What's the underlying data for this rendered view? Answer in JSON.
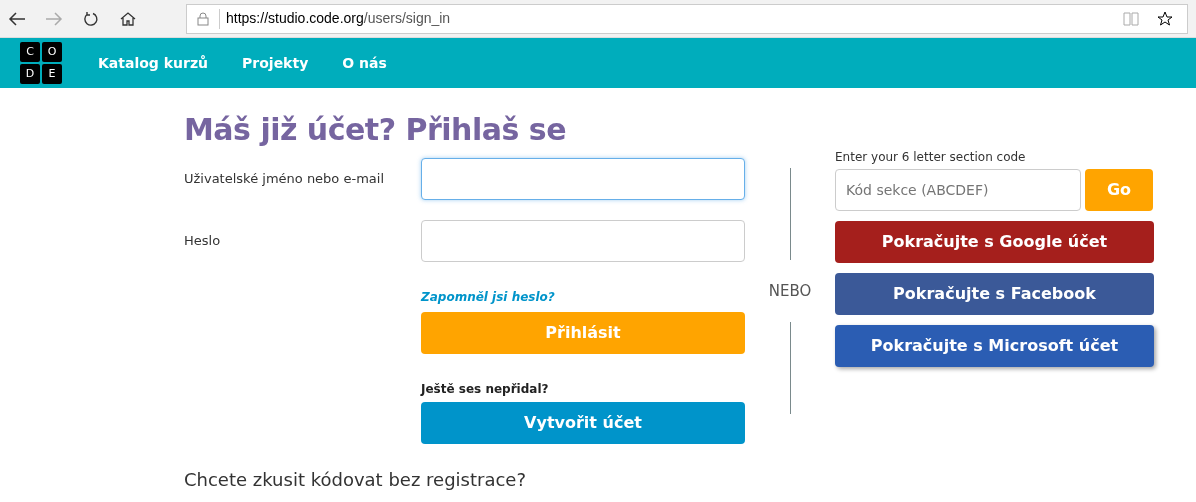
{
  "browser": {
    "url_host": "https://studio.code.org",
    "url_path": "/users/sign_in"
  },
  "navbar": {
    "logo_letters": [
      "C",
      "O",
      "D",
      "E"
    ],
    "links": [
      {
        "label": "Katalog kurzů"
      },
      {
        "label": "Projekty"
      },
      {
        "label": "O nás"
      }
    ]
  },
  "heading": "Máš již účet? Přihlaš se",
  "fields": [
    {
      "label": "Uživatelské jméno nebo e-mail",
      "focused": true
    },
    {
      "label": "Heslo",
      "focused": false
    }
  ],
  "forgot_link": "Zapomněl jsi heslo?",
  "sign_in_button": "Přihlásit",
  "signup_prompt": "Ještě ses nepřidal?",
  "signup_button": "Vytvořit účet",
  "divider_text": "NEBO",
  "section_code": {
    "label": "Enter your 6 letter section code",
    "placeholder": "Kód sekce (ABCDEF)",
    "button": "Go"
  },
  "social_buttons": [
    {
      "kind": "google",
      "label": "Pokračujte s Google účet"
    },
    {
      "kind": "facebook",
      "label": "Pokračujte s Facebook"
    },
    {
      "kind": "microsoft",
      "label": "Pokračujte s Microsoft účet"
    }
  ],
  "footer_question": "Chcete zkusit kódovat bez registrace?"
}
